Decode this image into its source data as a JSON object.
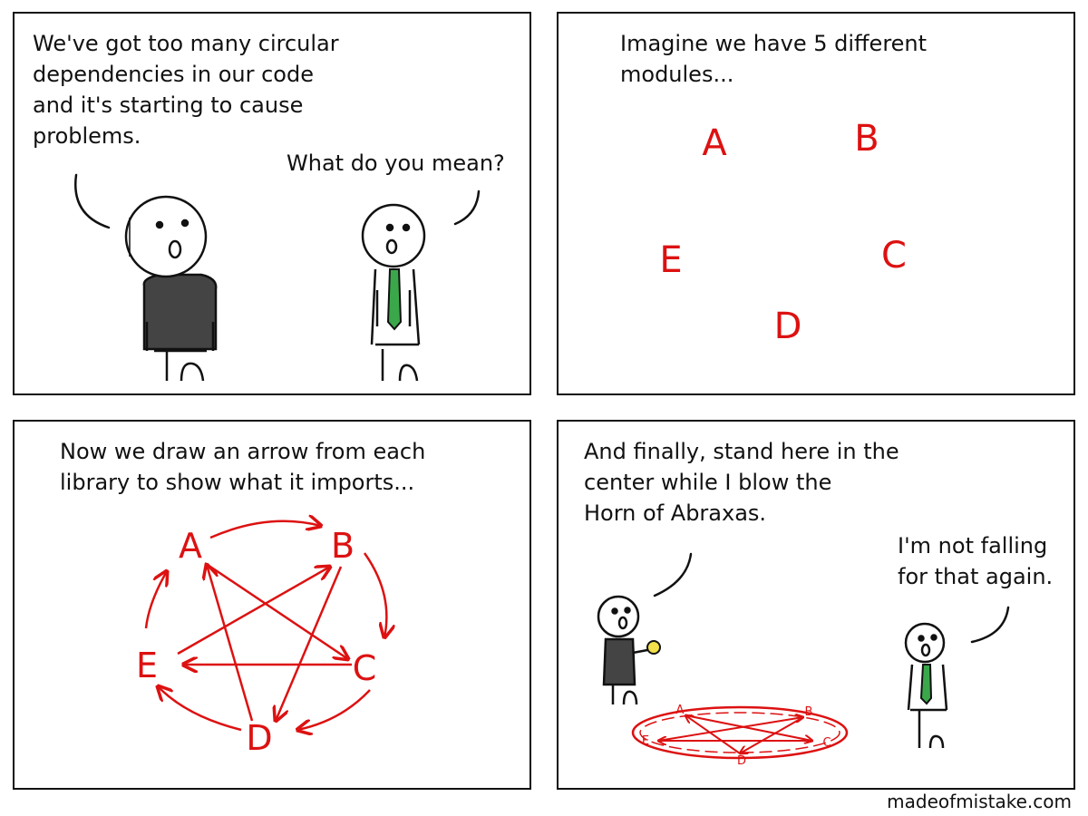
{
  "panels": [
    {
      "speech_1": "We've got too many circular\ndependencies in our code\nand it's starting to cause\nproblems.",
      "speech_2": "What do you mean?"
    },
    {
      "caption": "Imagine we have 5 different\nmodules...",
      "modules": [
        "A",
        "B",
        "C",
        "D",
        "E"
      ]
    },
    {
      "caption": "Now we draw an arrow from each\nlibrary to show what it imports...",
      "modules": [
        "A",
        "B",
        "C",
        "D",
        "E"
      ]
    },
    {
      "speech_1": "And finally, stand here in the\ncenter while I blow the\nHorn of Abraxas.",
      "speech_2": "I'm not falling\nfor that again.",
      "modules": [
        "A",
        "B",
        "C",
        "D",
        "E"
      ]
    }
  ],
  "credit": "madeofmistake.com",
  "colors": {
    "ink": "#111111",
    "circle_red": "#dd1111",
    "tie_green": "#3aa84a",
    "shirt_dark": "#444444"
  }
}
